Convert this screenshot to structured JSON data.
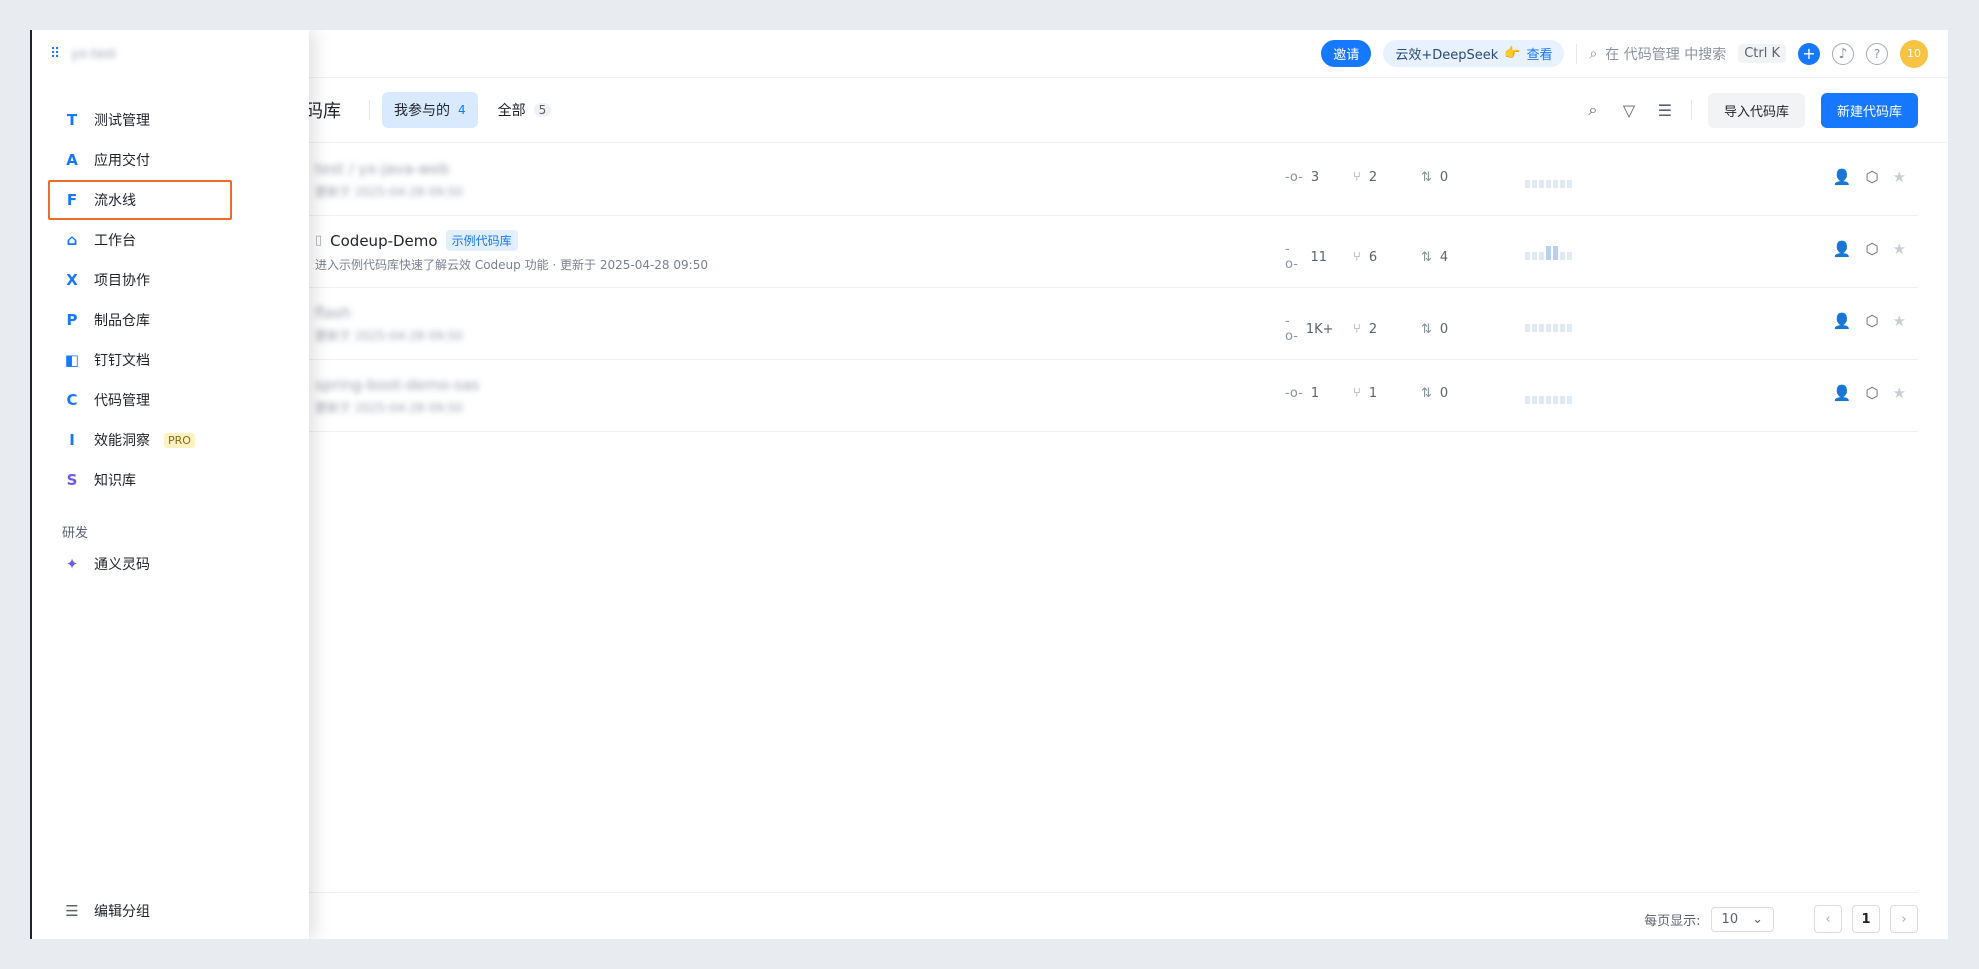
{
  "topbar": {
    "invite": "邀请",
    "deepseek": "云效+DeepSeek",
    "deepseek_link": "查看",
    "search_placeholder": "在 代码管理 中搜索",
    "shortcut": "Ctrl K",
    "avatar": "10"
  },
  "header": {
    "title": "码库",
    "tabs": [
      {
        "label": "我参与的",
        "count": "4"
      },
      {
        "label": "全部",
        "count": "5"
      }
    ],
    "import_label": "导入代码库",
    "new_label": "新建代码库"
  },
  "repos": [
    {
      "name": "test / yx-java-web",
      "desc": "更新于 2025-04-28 09:50",
      "commits": "3",
      "branches": "2",
      "mrs": "0",
      "color": "#8f95d6"
    },
    {
      "name": "Codeup-Demo",
      "tag": "示例代码库",
      "desc": "进入示例代码库快速了解云效 Codeup 功能 · 更新于 2025-04-28 09:50",
      "commits": "11",
      "branches": "6",
      "mrs": "4",
      "color": "#2e7fe8"
    },
    {
      "name": "flash",
      "desc": "更新于 2025-04-28 09:50",
      "commits": "1K+",
      "branches": "2",
      "mrs": "0",
      "color": "#7db8e3"
    },
    {
      "name": "spring-boot-demo-sas",
      "desc": "更新于 2025-04-28 09:50",
      "commits": "1",
      "branches": "1",
      "mrs": "0",
      "color": "#e6b56a"
    }
  ],
  "pagination": {
    "page_size_label": "每页显示:",
    "page_size": "10",
    "current_page": "1"
  },
  "sidebar": {
    "org": "yx-test",
    "items": [
      {
        "label": "测试管理",
        "icon": "T",
        "color": "#1677ff"
      },
      {
        "label": "应用交付",
        "icon": "A",
        "color": "#1677ff"
      },
      {
        "label": "流水线",
        "icon": "F",
        "color": "#1677ff"
      },
      {
        "label": "工作台",
        "icon": "⌂",
        "color": "#1677ff"
      },
      {
        "label": "项目协作",
        "icon": "X",
        "color": "#1677ff"
      },
      {
        "label": "制品仓库",
        "icon": "P",
        "color": "#1677ff"
      },
      {
        "label": "钉钉文档",
        "icon": "◧",
        "color": "#1677ff"
      },
      {
        "label": "代码管理",
        "icon": "C",
        "color": "#1677ff"
      },
      {
        "label": "效能洞察",
        "icon": "I",
        "color": "#1677ff",
        "badge": "PRO"
      },
      {
        "label": "知识库",
        "icon": "S",
        "color": "#6b5ce7"
      }
    ],
    "section": "研发",
    "section_items": [
      {
        "label": "通义灵码",
        "icon": "✦",
        "color": "#6b5ce7"
      }
    ],
    "bottom_item": {
      "label": "编辑分组",
      "icon": "☰"
    }
  }
}
